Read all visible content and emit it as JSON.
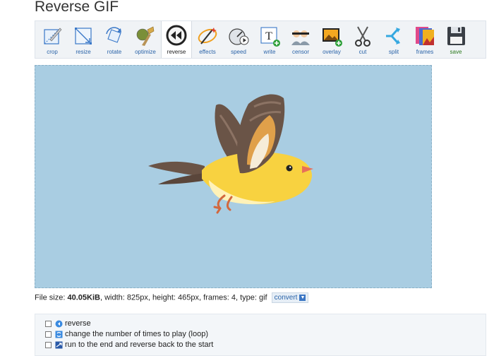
{
  "page": {
    "title": "Reverse GIF"
  },
  "toolbar": {
    "tools": [
      {
        "label": "crop"
      },
      {
        "label": "resize"
      },
      {
        "label": "rotate"
      },
      {
        "label": "optimize"
      },
      {
        "label": "reverse"
      },
      {
        "label": "effects"
      },
      {
        "label": "speed"
      },
      {
        "label": "write"
      },
      {
        "label": "censor"
      },
      {
        "label": "overlay"
      },
      {
        "label": "cut"
      },
      {
        "label": "split"
      },
      {
        "label": "frames"
      },
      {
        "label": "save"
      }
    ],
    "active": "reverse"
  },
  "fileinfo": {
    "size_label": "File size: ",
    "size_value": "40.05KiB",
    "details": ", width: 825px, height: 465px, frames: 4, type: gif",
    "convert_label": "convert"
  },
  "options": [
    {
      "label": "reverse"
    },
    {
      "label": "change the number of times to play (loop)"
    },
    {
      "label": "run to the end and reverse back to the start"
    }
  ],
  "colors": {
    "preview_bg": "#a9cde2",
    "link": "#2a63a8",
    "save": "#2c7a1e"
  }
}
